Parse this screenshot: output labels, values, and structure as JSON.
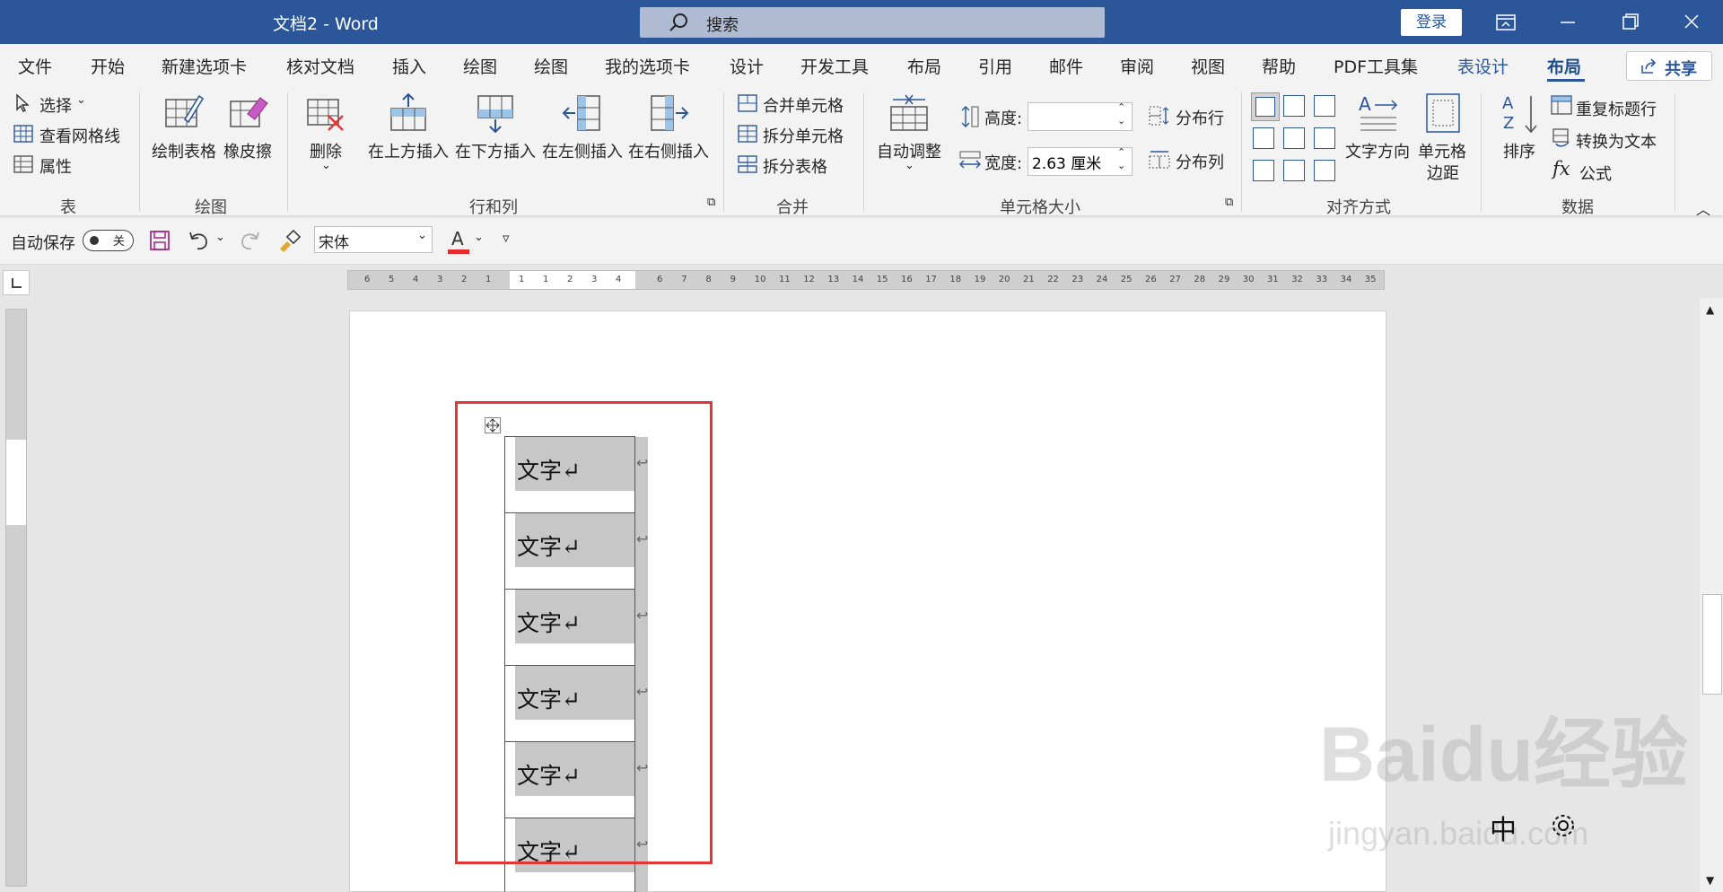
{
  "titlebar": {
    "title": "文档2  -  Word",
    "search_label": "搜索",
    "login_label": "登录"
  },
  "tabs": [
    "文件",
    "开始",
    "新建选项卡",
    "核对文档",
    "插入",
    "绘图",
    "绘图",
    "我的选项卡",
    "设计",
    "开发工具",
    "布局",
    "引用",
    "邮件",
    "审阅",
    "视图",
    "帮助",
    "PDF工具集",
    "表设计",
    "布局"
  ],
  "share_label": "共享",
  "ribbon": {
    "table": {
      "select": "选择",
      "gridlines": "查看网格线",
      "properties": "属性",
      "group": "表"
    },
    "draw": {
      "draw_table": "绘制表格",
      "eraser": "橡皮擦",
      "group": "绘图"
    },
    "rowscols": {
      "delete": "删除",
      "insert_above": "在上方插入",
      "insert_below": "在下方插入",
      "insert_left": "在左侧插入",
      "insert_right": "在右侧插入",
      "group": "行和列"
    },
    "merge": {
      "merge_cells": "合并单元格",
      "split_cells": "拆分单元格",
      "split_table": "拆分表格",
      "group": "合并"
    },
    "cellsize": {
      "autofit": "自动调整",
      "height_label": "高度:",
      "height_value": "",
      "width_label": "宽度:",
      "width_value": "2.63 厘米",
      "dist_rows": "分布行",
      "dist_cols": "分布列",
      "group": "单元格大小"
    },
    "align": {
      "text_direction": "文字方向",
      "cell_margins_1": "单元格",
      "cell_margins_2": "边距",
      "group": "对齐方式"
    },
    "data": {
      "sort": "排序",
      "repeat_header": "重复标题行",
      "convert_text": "转换为文本",
      "formula": "公式",
      "group": "数据"
    }
  },
  "qat": {
    "autosave_label": "自动保存",
    "autosave_state": "关",
    "font_name": "宋体"
  },
  "hruler_left": [
    "6",
    "5",
    "4",
    "3",
    "2",
    "1"
  ],
  "hruler_white": [
    "1",
    "1",
    "2",
    "3",
    "4"
  ],
  "hruler_right": [
    "6",
    "7",
    "8",
    "9",
    "10",
    "11",
    "12",
    "13",
    "14",
    "15",
    "16",
    "17",
    "18",
    "19",
    "20",
    "21",
    "22",
    "23",
    "24",
    "25",
    "26",
    "27",
    "28",
    "29",
    "30",
    "31",
    "32",
    "33",
    "34",
    "35"
  ],
  "document": {
    "cell_text": "文字↵",
    "row_mark": "↩"
  },
  "watermark": {
    "brand": "Baidu经验",
    "url": "jingyan.baidu.com"
  },
  "ime": {
    "mode": "中"
  }
}
